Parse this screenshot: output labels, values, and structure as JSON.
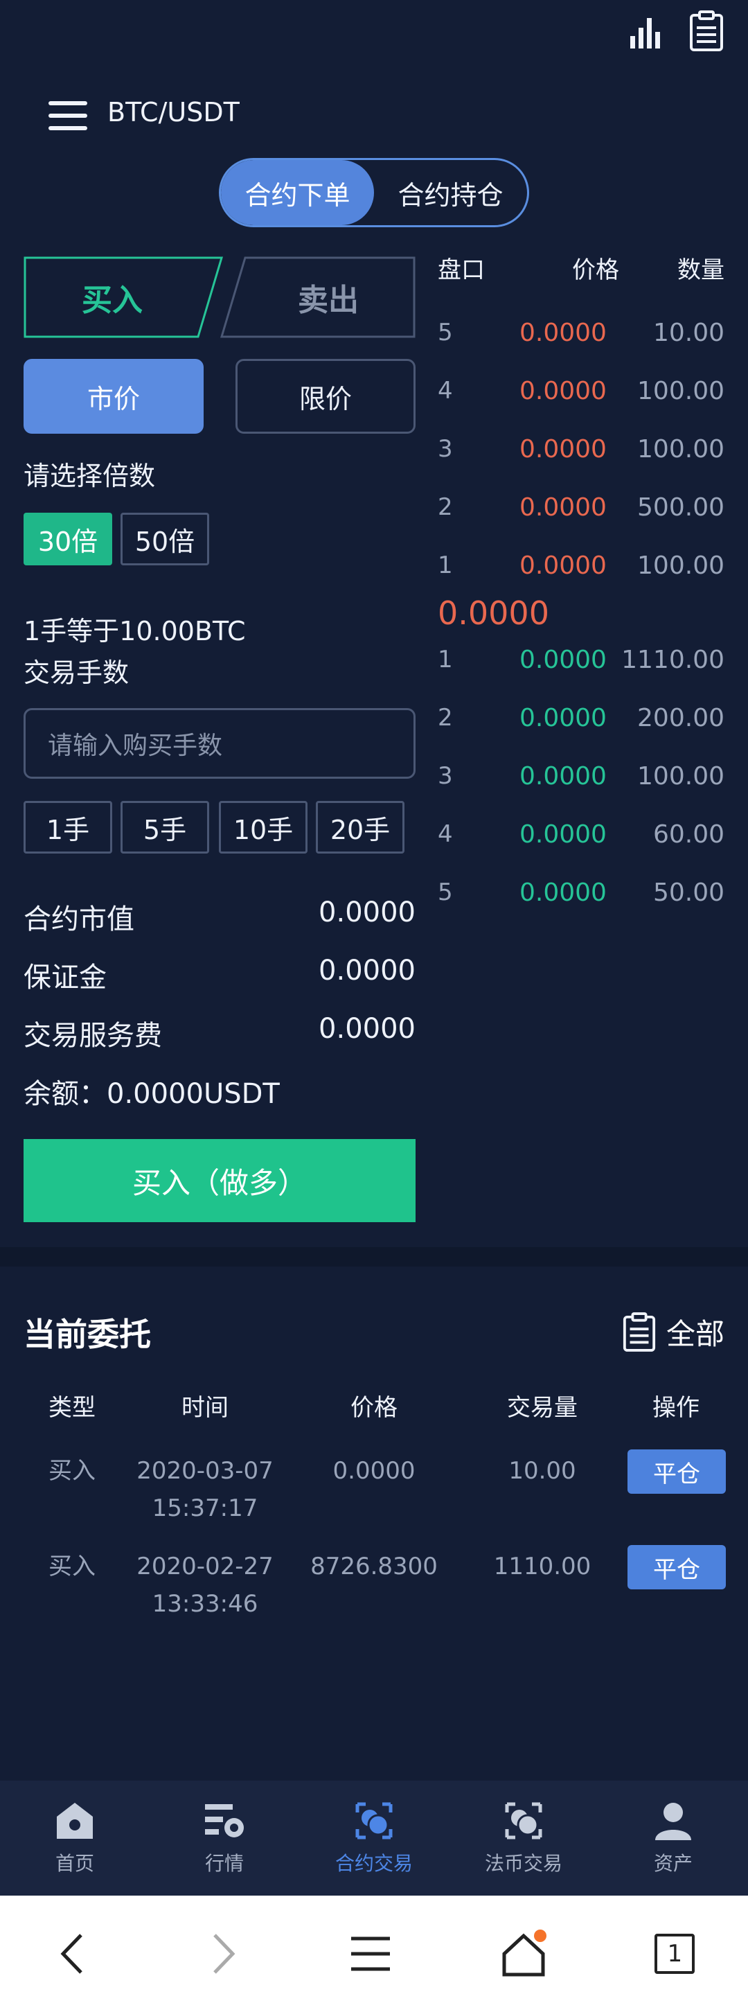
{
  "header": {
    "title": "BTC/USDT",
    "icons": [
      "bar-chart-icon",
      "clipboard-icon",
      "menu-icon"
    ]
  },
  "segment": {
    "order_tab": "合约下单",
    "position_tab": "合约持仓"
  },
  "trade": {
    "buy_tab": "买入",
    "sell_tab": "卖出",
    "market_label": "市价",
    "limit_label": "限价",
    "leverage_title": "请选择倍数",
    "leverage_options": [
      "30倍",
      "50倍"
    ],
    "unit_info": "1手等于10.00BTC",
    "lots_label": "交易手数",
    "lots_placeholder": "请输入购买手数",
    "lot_buttons": [
      "1手",
      "5手",
      "10手",
      "20手"
    ],
    "contract_value_label": "合约市值",
    "contract_value": "0.0000",
    "margin_label": "保证金",
    "margin": "0.0000",
    "fee_label": "交易服务费",
    "fee": "0.0000",
    "balance": "余额：0.0000USDT",
    "buy_button": "买入（做多）"
  },
  "orderbook": {
    "headers": [
      "盘口",
      "价格",
      "数量"
    ],
    "asks": [
      {
        "idx": "5",
        "price": "0.0000",
        "qty": "10.00"
      },
      {
        "idx": "4",
        "price": "0.0000",
        "qty": "100.00"
      },
      {
        "idx": "3",
        "price": "0.0000",
        "qty": "100.00"
      },
      {
        "idx": "2",
        "price": "0.0000",
        "qty": "500.00"
      },
      {
        "idx": "1",
        "price": "0.0000",
        "qty": "100.00"
      }
    ],
    "last_price": "0.0000",
    "bids": [
      {
        "idx": "1",
        "price": "0.0000",
        "qty": "1110.00"
      },
      {
        "idx": "2",
        "price": "0.0000",
        "qty": "200.00"
      },
      {
        "idx": "3",
        "price": "0.0000",
        "qty": "100.00"
      },
      {
        "idx": "4",
        "price": "0.0000",
        "qty": "60.00"
      },
      {
        "idx": "5",
        "price": "0.0000",
        "qty": "50.00"
      }
    ],
    "colors": {
      "ask": "#e9684f",
      "bid": "#26c497"
    }
  },
  "orders": {
    "title": "当前委托",
    "all_label": "全部",
    "columns": [
      "类型",
      "时间",
      "价格",
      "交易量",
      "操作"
    ],
    "rows": [
      {
        "type": "买入",
        "date": "2020-03-07",
        "time": "15:37:17",
        "price": "0.0000",
        "volume": "10.00",
        "action": "平仓"
      },
      {
        "type": "买入",
        "date": "2020-02-27",
        "time": "13:33:46",
        "price": "8726.8300",
        "volume": "1110.00",
        "action": "平仓"
      }
    ]
  },
  "bottom_nav": {
    "items": [
      {
        "label": "首页",
        "icon": "home-icon"
      },
      {
        "label": "行情",
        "icon": "market-icon"
      },
      {
        "label": "合约交易",
        "icon": "contract-icon"
      },
      {
        "label": "法币交易",
        "icon": "fiat-icon"
      },
      {
        "label": "资产",
        "icon": "user-icon"
      }
    ],
    "active_index": 2
  },
  "browser": {
    "tab_count": "1"
  }
}
